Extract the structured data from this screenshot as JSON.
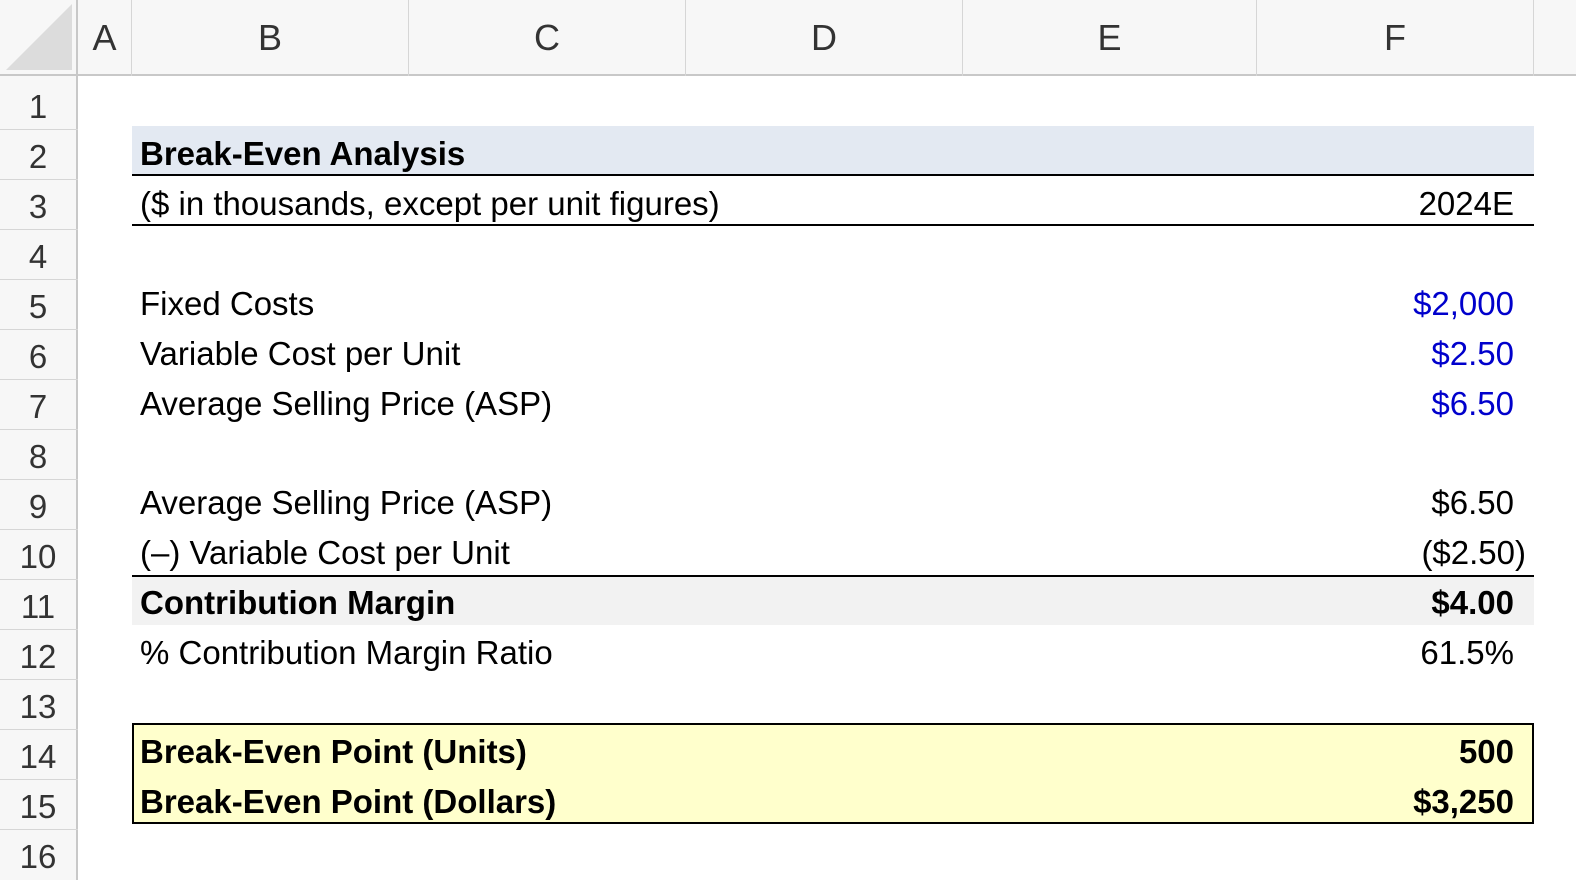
{
  "columns": [
    "A",
    "B",
    "C",
    "D",
    "E",
    "F"
  ],
  "rows": [
    "1",
    "2",
    "3",
    "4",
    "5",
    "6",
    "7",
    "8",
    "9",
    "10",
    "11",
    "12",
    "13",
    "14",
    "15",
    "16"
  ],
  "sheet": {
    "title": "Break-Even Analysis",
    "subtitle": "($ in thousands, except per unit figures)",
    "period": "2024E",
    "inputs": [
      {
        "label": "Fixed Costs",
        "value": "$2,000"
      },
      {
        "label": "Variable Cost per Unit",
        "value": "$2.50"
      },
      {
        "label": "Average Selling Price (ASP)",
        "value": "$6.50"
      }
    ],
    "calc": [
      {
        "label": "Average Selling Price (ASP)",
        "value": "$6.50"
      },
      {
        "label": "(–) Variable Cost per Unit",
        "value": "($2.50)"
      }
    ],
    "contribution_margin": {
      "label": "Contribution Margin",
      "value": "$4.00"
    },
    "cm_ratio": {
      "label": "% Contribution Margin Ratio",
      "value": "61.5%"
    },
    "bep_units": {
      "label": "Break-Even Point (Units)",
      "value": "500"
    },
    "bep_dollars": {
      "label": "Break-Even Point (Dollars)",
      "value": "$3,250"
    }
  },
  "colors": {
    "input_blue": "#0000cc",
    "title_band": "#e3e9f2",
    "cm_band": "#f2f2f2",
    "bep_band": "#ffffcc"
  }
}
